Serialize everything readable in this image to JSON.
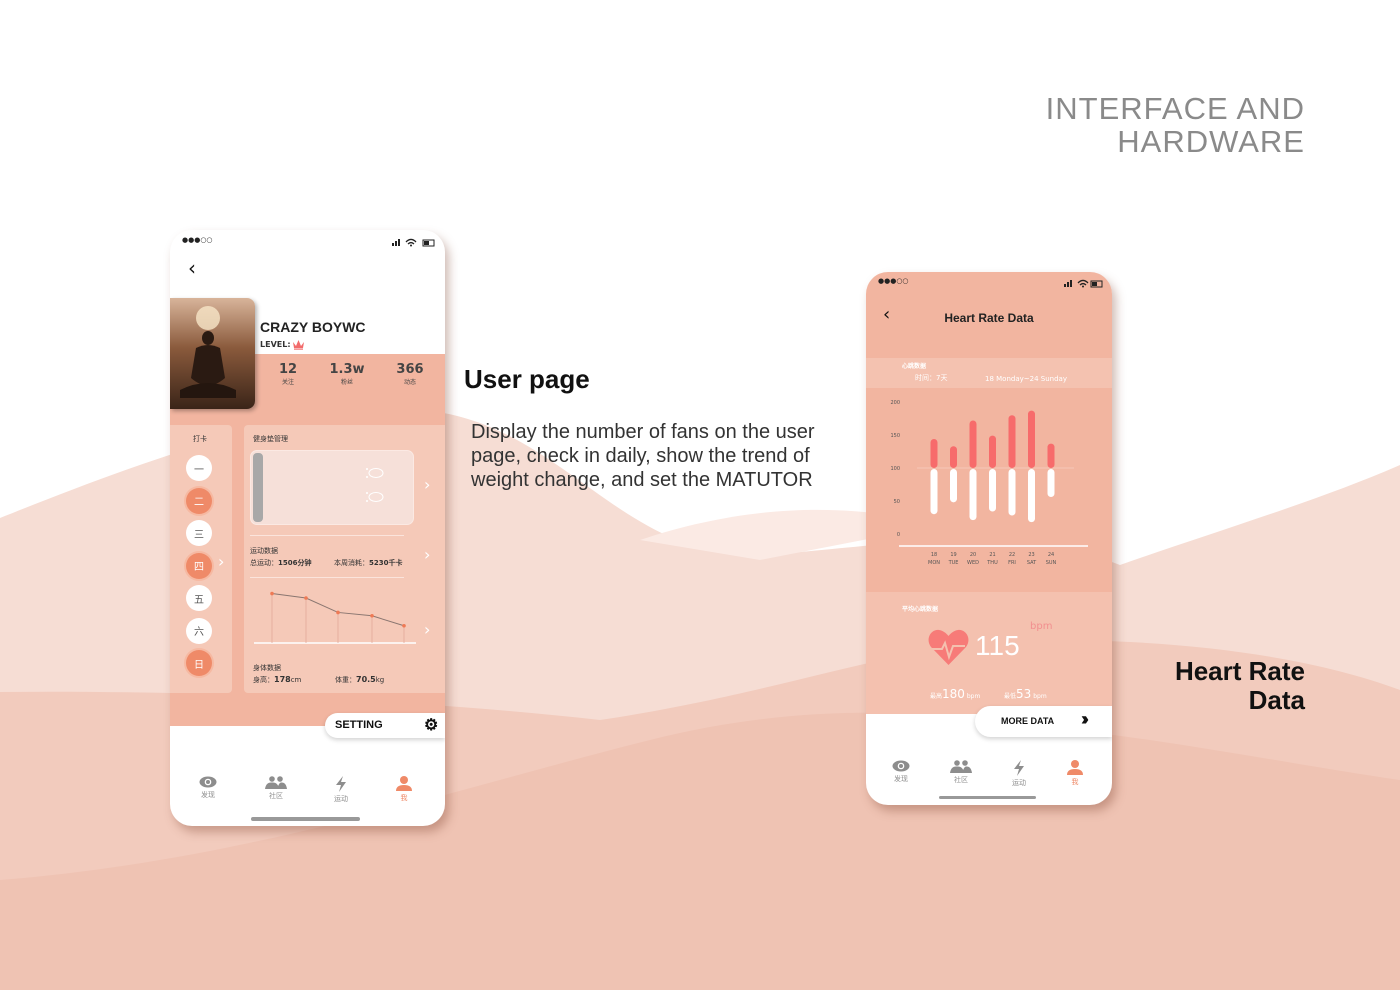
{
  "header": {
    "line1": "INTERFACE AND",
    "line2": "HARDWARE"
  },
  "user_section": {
    "title": "User page",
    "description": "Display the number of fans on the user page, check in daily, show the trend of weight change, and set the MATUTOR"
  },
  "heart_section": {
    "title_line1": "Heart Rate",
    "title_line2": "Data"
  },
  "colors": {
    "accent": "#ef8a68",
    "band": "#f2b5a0",
    "panel": "#f5c9b8",
    "heart": "#f76b6b"
  },
  "user_page": {
    "status_dots": "●●●○○",
    "name": "CRAZY BOYWC",
    "level_label": "LEVEL:",
    "stats": [
      {
        "value": "12",
        "label": "关注"
      },
      {
        "value": "1.3w",
        "label": "粉丝"
      },
      {
        "value": "366",
        "label": "动态"
      }
    ],
    "checkin": {
      "title": "打卡",
      "days": [
        {
          "label": "一",
          "checked": false
        },
        {
          "label": "二",
          "checked": true
        },
        {
          "label": "三",
          "checked": false
        },
        {
          "label": "四",
          "checked": true
        },
        {
          "label": "五",
          "checked": false
        },
        {
          "label": "六",
          "checked": false
        },
        {
          "label": "日",
          "checked": true
        }
      ]
    },
    "mat": {
      "title": "健身垫管理"
    },
    "exercise": {
      "title": "运动数据",
      "total_label": "总运动：",
      "total_value": "1506分钟",
      "burn_label": "本周消耗：",
      "burn_value": "5230千卡"
    },
    "weight_trend": [
      100,
      96,
      83,
      80,
      71
    ],
    "body": {
      "title": "身体数据",
      "height_label": "身高：",
      "height_value": "178",
      "height_unit": "cm",
      "weight_label": "体重：",
      "weight_value": "70.5",
      "weight_unit": "kg"
    },
    "setting_label": "SETTING",
    "nav": [
      {
        "label": "发现",
        "icon": "eye-icon",
        "active": false
      },
      {
        "label": "社区",
        "icon": "community-icon",
        "active": false
      },
      {
        "label": "运动",
        "icon": "lightning-icon",
        "active": false
      },
      {
        "label": "我",
        "icon": "user-icon",
        "active": true
      }
    ]
  },
  "heart_page": {
    "status_dots": "●●●○○",
    "title": "Heart Rate Data",
    "section_label": "心跳数据",
    "time_label": "时间：7天",
    "range": "18 Monday~24 Sunday",
    "avg_label": "平均心跳数据",
    "avg_value": "115",
    "unit": "bpm",
    "max_label": "最高",
    "max_value": "180",
    "min_label": "最低",
    "min_value": "53",
    "more_label": "MORE DATA",
    "nav": [
      {
        "label": "发现",
        "icon": "eye-icon",
        "active": false
      },
      {
        "label": "社区",
        "icon": "community-icon",
        "active": false
      },
      {
        "label": "运动",
        "icon": "lightning-icon",
        "active": false
      },
      {
        "label": "我",
        "icon": "user-icon",
        "active": true
      }
    ]
  },
  "chart_data": {
    "type": "bar",
    "yticks": [
      "200",
      "150",
      "100",
      "50",
      "0"
    ],
    "ylim": [
      0,
      200
    ],
    "baseline": 100,
    "categories": [
      {
        "day": "18",
        "week": "MON"
      },
      {
        "day": "19",
        "week": "TUE"
      },
      {
        "day": "20",
        "week": "WED"
      },
      {
        "day": "21",
        "week": "THU"
      },
      {
        "day": "22",
        "week": "FRI"
      },
      {
        "day": "23",
        "week": "SAT"
      },
      {
        "day": "24",
        "week": "SUN"
      }
    ],
    "series": [
      {
        "values": [
          144,
          133,
          172,
          149,
          180,
          187,
          137
        ],
        "color": "#f76b6b"
      },
      {
        "values": [
          30,
          48,
          21,
          34,
          28,
          18,
          56
        ],
        "color": "#ffffff"
      }
    ]
  }
}
